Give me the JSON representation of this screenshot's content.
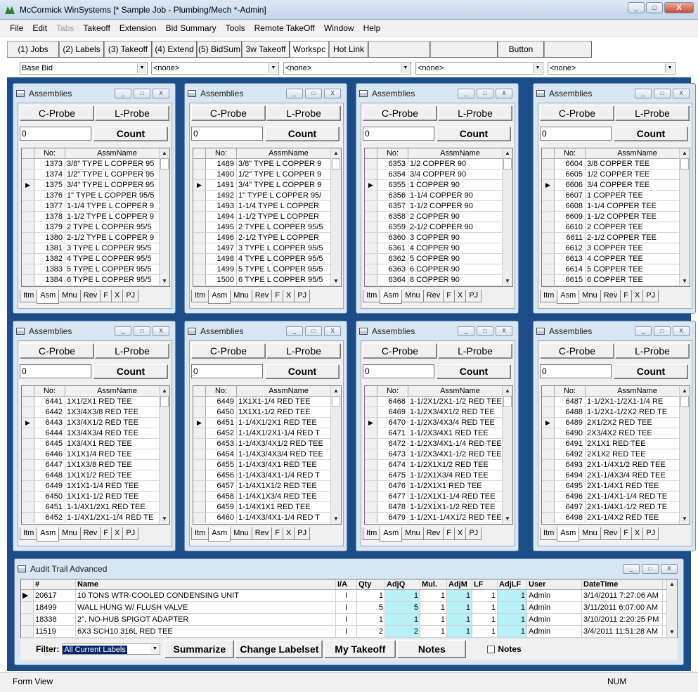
{
  "window": {
    "title": "McCormick WinSystems [* Sample Job - Plumbing/Mech *-Admin]",
    "min": "_",
    "max": "□",
    "close": "X"
  },
  "menu": [
    {
      "label": "File",
      "disabled": false
    },
    {
      "label": "Edit",
      "disabled": false
    },
    {
      "label": "Tabs",
      "disabled": true
    },
    {
      "label": "Takeoff",
      "disabled": false
    },
    {
      "label": "Extension",
      "disabled": false
    },
    {
      "label": "Bid Summary",
      "disabled": false
    },
    {
      "label": "Tools",
      "disabled": false
    },
    {
      "label": "Remote TakeOff",
      "disabled": false
    },
    {
      "label": "Window",
      "disabled": false
    },
    {
      "label": "Help",
      "disabled": false
    }
  ],
  "toolbar": [
    "(1) Jobs",
    "(2) Labels",
    "(3) Takeoff",
    "(4) Extend",
    "(5) BidSum",
    "3w Takeoff",
    "Workspc",
    "Hot Link",
    "",
    "",
    "Button",
    ""
  ],
  "combos": [
    "Base Bid",
    "<none>",
    "<none>",
    "<none>",
    "<none>"
  ],
  "assembly_common": {
    "title": "Assemblies",
    "cprobe": "C-Probe",
    "lprobe": "L-Probe",
    "count_value": "0",
    "count_label": "Count",
    "col_no": "No:",
    "col_name": "AssmName",
    "tabs": [
      "Itm",
      "Asm",
      "Mnu",
      "Rev",
      "F",
      "X",
      "PJ"
    ]
  },
  "panels": [
    {
      "rows": [
        [
          "1373",
          "3/8\" TYPE L COPPER 95"
        ],
        [
          "1374",
          "1/2\" TYPE L COPPER 95"
        ],
        [
          "1375",
          "3/4\" TYPE L COPPER 95"
        ],
        [
          "1376",
          "1\" TYPE L COPPER 95/5"
        ],
        [
          "1377",
          "1-1/4 TYPE L COPPER 9"
        ],
        [
          "1378",
          "1-1/2 TYPE L COPPER 9"
        ],
        [
          "1379",
          "2 TYPE L COPPER 95/5"
        ],
        [
          "1380",
          "2-1/2 TYPE L COPPER 9"
        ],
        [
          "1381",
          "3 TYPE L COPPER 95/5"
        ],
        [
          "1382",
          "4 TYPE L COPPER 95/5"
        ],
        [
          "1383",
          "5 TYPE L COPPER 95/5"
        ],
        [
          "1384",
          "6 TYPE L COPPER 95/5"
        ]
      ]
    },
    {
      "rows": [
        [
          "1489",
          "3/8\" TYPE L COPPER 9"
        ],
        [
          "1490",
          "1/2\" TYPE L COPPER 9"
        ],
        [
          "1491",
          "3/4\" TYPE L COPPER 9"
        ],
        [
          "1492",
          "1\" TYPE L COPPER 95/"
        ],
        [
          "1493",
          "1-1/4 TYPE L COPPER"
        ],
        [
          "1494",
          "1-1/2 TYPE L COPPER"
        ],
        [
          "1495",
          "2 TYPE L COPPER 95/5"
        ],
        [
          "1496",
          "2-1/2 TYPE L COPPER"
        ],
        [
          "1497",
          "3 TYPE L COPPER 95/5"
        ],
        [
          "1498",
          "4 TYPE L COPPER 95/5"
        ],
        [
          "1499",
          "5 TYPE L COPPER 95/5"
        ],
        [
          "1500",
          "6 TYPE L COPPER 95/5"
        ]
      ]
    },
    {
      "rows": [
        [
          "6353",
          "1/2 COPPER 90"
        ],
        [
          "6354",
          "3/4 COPPER 90"
        ],
        [
          "6355",
          "1 COPPER 90"
        ],
        [
          "6356",
          "1-1/4 COPPER 90"
        ],
        [
          "6357",
          "1-1/2 COPPER 90"
        ],
        [
          "6358",
          "2 COPPER 90"
        ],
        [
          "6359",
          "2-1/2 COPPER 90"
        ],
        [
          "6360",
          "3 COPPER 90"
        ],
        [
          "6361",
          "4 COPPER 90"
        ],
        [
          "6362",
          "5 COPPER 90"
        ],
        [
          "6363",
          "6 COPPER 90"
        ],
        [
          "6364",
          "8 COPPER 90"
        ]
      ]
    },
    {
      "rows": [
        [
          "6604",
          "3/8 COPPER TEE"
        ],
        [
          "6605",
          "1/2 COPPER TEE"
        ],
        [
          "6606",
          "3/4 COPPER TEE"
        ],
        [
          "6607",
          "1 COPPER TEE"
        ],
        [
          "6608",
          "1-1/4 COPPER TEE"
        ],
        [
          "6609",
          "1-1/2 COPPER TEE"
        ],
        [
          "6610",
          "2 COPPER TEE"
        ],
        [
          "6611",
          "2-1/2 COPPER TEE"
        ],
        [
          "6612",
          "3 COPPER TEE"
        ],
        [
          "6613",
          "4 COPPER TEE"
        ],
        [
          "6614",
          "5 COPPER TEE"
        ],
        [
          "6615",
          "6 COPPER TEE"
        ]
      ]
    },
    {
      "rows": [
        [
          "6441",
          "1X1/2X1 RED TEE"
        ],
        [
          "6442",
          "1X3/4X3/8 RED TEE"
        ],
        [
          "6443",
          "1X3/4X1/2 RED TEE"
        ],
        [
          "6444",
          "1X3/4X3/4 RED TEE"
        ],
        [
          "6445",
          "1X3/4X1 RED TEE"
        ],
        [
          "6446",
          "1X1X1/4 RED TEE"
        ],
        [
          "6447",
          "1X1X3/8 RED TEE"
        ],
        [
          "6448",
          "1X1X1/2 RED TEE"
        ],
        [
          "6449",
          "1X1X1-1/4 RED TEE"
        ],
        [
          "6450",
          "1X1X1-1/2 RED TEE"
        ],
        [
          "6451",
          "1-1/4X1/2X1 RED TEE"
        ],
        [
          "6452",
          "1-1/4X1/2X1-1/4 RED TE"
        ]
      ]
    },
    {
      "rows": [
        [
          "6449",
          "1X1X1-1/4 RED TEE"
        ],
        [
          "6450",
          "1X1X1-1/2 RED TEE"
        ],
        [
          "6451",
          "1-1/4X1/2X1 RED TEE"
        ],
        [
          "6452",
          "1-1/4X1/2X1-1/4 RED T"
        ],
        [
          "6453",
          "1-1/4X3/4X1/2 RED TEE"
        ],
        [
          "6454",
          "1-1/4X3/4X3/4 RED TEE"
        ],
        [
          "6455",
          "1-1/4X3/4X1 RED TEE"
        ],
        [
          "6456",
          "1-1/4X3/4X1-1/4 RED T"
        ],
        [
          "6457",
          "1-1/4X1X1/2 RED TEE"
        ],
        [
          "6458",
          "1-1/4X1X3/4 RED TEE"
        ],
        [
          "6459",
          "1-1/4X1X1 RED TEE"
        ],
        [
          "6460",
          "1-1/4X3/4X1-1/4 RED T"
        ]
      ]
    },
    {
      "rows": [
        [
          "6468",
          "1-1/2X1/2X1-1/2 RED TEE"
        ],
        [
          "6469",
          "1-1/2X3/4X1/2 RED TEE"
        ],
        [
          "6470",
          "1-1/2X3/4X3/4 RED TEE"
        ],
        [
          "6471",
          "1-1/2X3/4X1 RED TEE"
        ],
        [
          "6472",
          "1-1/2X3/4X1-1/4 RED TEE"
        ],
        [
          "6473",
          "1-1/2X3/4X1-1/2 RED TEE"
        ],
        [
          "6474",
          "1-1/2X1X1/2 RED TEE"
        ],
        [
          "6475",
          "1-1/2X1X3/4 RED TEE"
        ],
        [
          "6476",
          "1-1/2X1X1 RED TEE"
        ],
        [
          "6477",
          "1-1/2X1X1-1/4 RED TEE"
        ],
        [
          "6478",
          "1-1/2X1X1-1/2 RED TEE"
        ],
        [
          "6479",
          "1-1/2X1-1/4X1/2 RED TEE"
        ]
      ]
    },
    {
      "rows": [
        [
          "6487",
          "1-1/2X1-1/2X1-1/4 RE"
        ],
        [
          "6488",
          "1-1/2X1-1/2X2 RED TE"
        ],
        [
          "6489",
          "2X1/2X2 RED TEE"
        ],
        [
          "6490",
          "2X3/4X2 RED TEE"
        ],
        [
          "6491",
          "2X1X1 RED TEE"
        ],
        [
          "6492",
          "2X1X2 RED TEE"
        ],
        [
          "6493",
          "2X1-1/4X1/2 RED TEE"
        ],
        [
          "6494",
          "2X1-1/4X3/4 RED TEE"
        ],
        [
          "6495",
          "2X1-1/4X1 RED TEE"
        ],
        [
          "6496",
          "2X1-1/4X1-1/4 RED TE"
        ],
        [
          "6497",
          "2X1-1/4X1-1/2 RED TE"
        ],
        [
          "6498",
          "2X1-1/4X2 RED TEE"
        ]
      ]
    }
  ],
  "audit": {
    "title": "Audit Trail Advanced",
    "columns": [
      "#",
      "Name",
      "I/A",
      "Qty",
      "AdjQ",
      "Mul.",
      "AdjM",
      "LF",
      "AdjLF",
      "User",
      "DateTime"
    ],
    "rows": [
      [
        "20617",
        "10 TONS WTR-COOLED CONDENSING UNIT",
        "I",
        "1",
        "1",
        "1",
        "1",
        "1",
        "1",
        "Admin",
        "3/14/2011 7:27:06 AM"
      ],
      [
        "18499",
        "WALL HUNG W/ FLUSH VALVE",
        "I",
        "5",
        "5",
        "1",
        "1",
        "1",
        "1",
        "Admin",
        "3/11/2011 6:07:00 AM"
      ],
      [
        "18338",
        "2\". NO-HUB SPIGOT ADAPTER",
        "I",
        "1",
        "1",
        "1",
        "1",
        "1",
        "1",
        "Admin",
        "3/10/2011 2:20:25 PM"
      ],
      [
        "11519",
        "6X3 SCH10 316L RED TEE",
        "I",
        "2",
        "2",
        "1",
        "1",
        "1",
        "1",
        "Admin",
        "3/4/2011 11:51:28 AM"
      ]
    ],
    "filter_label": "Filter:",
    "filter_value": "All Current Labels",
    "summarize": "Summarize",
    "change_labelset": "Change Labelset",
    "my_takeoff": "My Takeoff",
    "notes_button": "Notes",
    "notes_check": "Notes"
  },
  "status": {
    "left": "Form View",
    "right": "NUM"
  }
}
